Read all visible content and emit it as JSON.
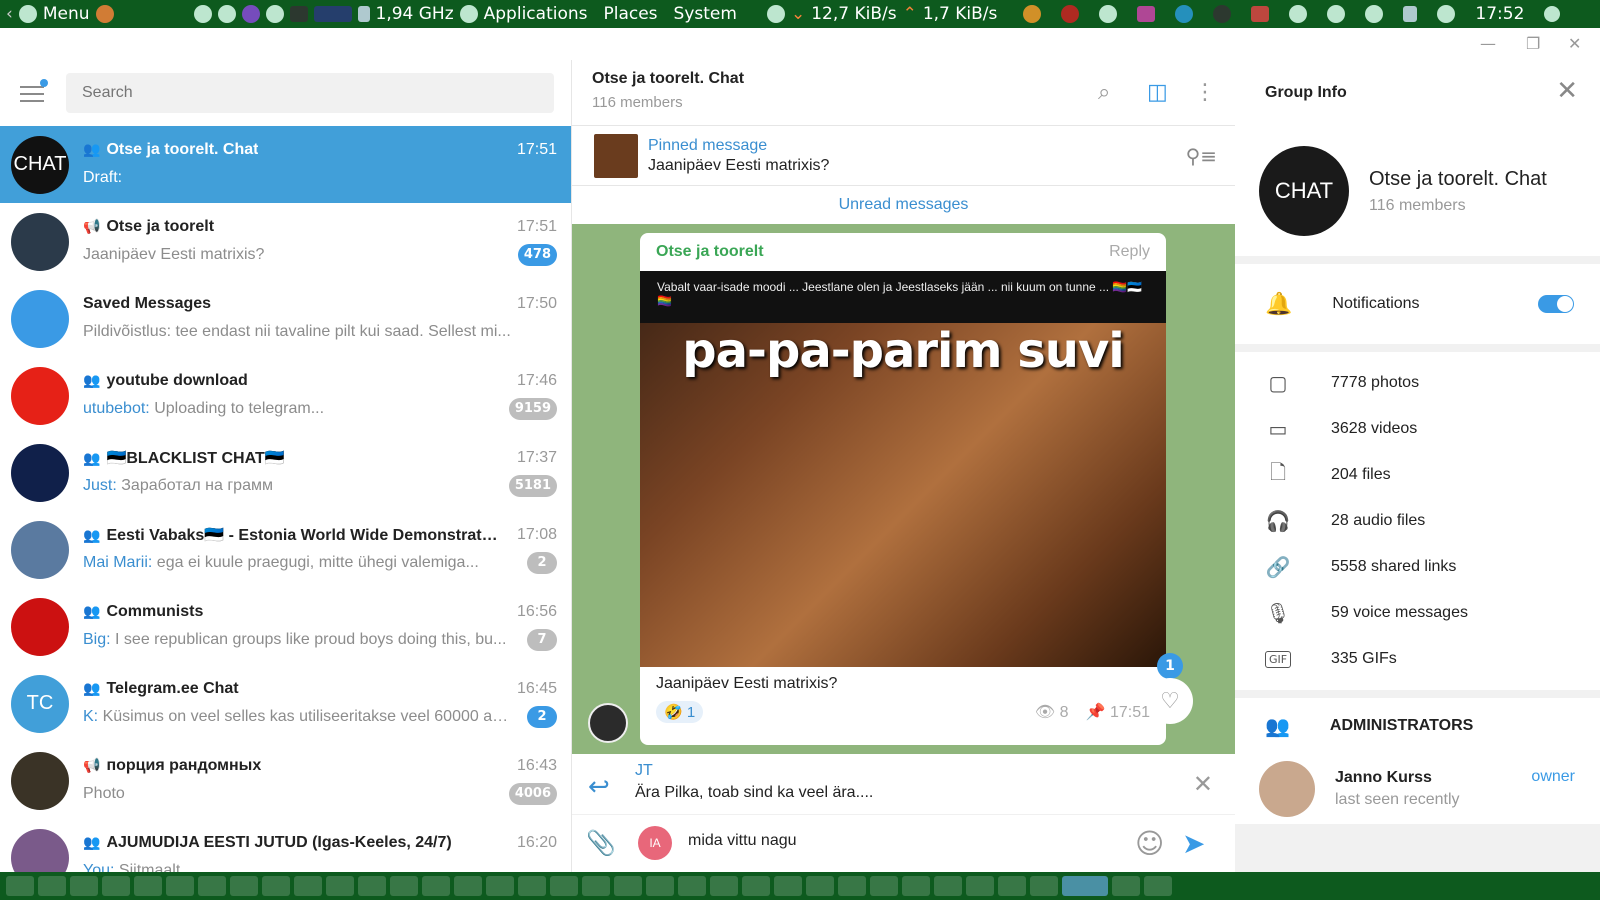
{
  "sysbar": {
    "menu": "Menu",
    "cpu": "1,94 GHz",
    "applications": "Applications",
    "places": "Places",
    "system": "System",
    "net_down": "12,7 KiB/s",
    "net_up": "1,7 KiB/s",
    "clock": "17:52"
  },
  "search": {
    "placeholder": "Search"
  },
  "chats": [
    {
      "name": "Otse ja toorelt. Chat",
      "time": "17:51",
      "preview": "Draft:",
      "sender": "",
      "badge": "",
      "avatar_text": "CHAT",
      "kind": "group",
      "color": "#111111"
    },
    {
      "name": "Otse ja toorelt",
      "time": "17:51",
      "preview": "Jaanipäev Eesti matrixis?",
      "sender": "",
      "badge": "478",
      "avatar_text": "",
      "kind": "channel",
      "color": "#2b3a4a"
    },
    {
      "name": "Saved Messages",
      "time": "17:50",
      "preview": "Pildivõistlus: tee endast nii tavaline pilt kui saad. Sellest mi...",
      "sender": "",
      "badge": "",
      "avatar_text": "",
      "kind": "saved",
      "color": "#3a9ae5"
    },
    {
      "name": "youtube download",
      "time": "17:46",
      "preview": "Uploading to telegram...",
      "sender": "utubebot:",
      "badge": "9159",
      "avatar_text": "",
      "kind": "group",
      "color": "#e62117"
    },
    {
      "name": "🇪🇪BLACKLIST CHAT🇪🇪",
      "time": "17:37",
      "preview": "Заработал на грамм",
      "sender": "Just:",
      "badge": "5181",
      "avatar_text": "",
      "kind": "group",
      "color": "#10204a"
    },
    {
      "name": "Eesti Vabaks🇪🇪 - Estonia World Wide Demonstrati...",
      "time": "17:08",
      "preview": "ega ei kuule praegugi, mitte ühegi valemiga...",
      "sender": "Mai Marii:",
      "badge": "2",
      "avatar_text": "",
      "kind": "group",
      "color": "#5a7aa0"
    },
    {
      "name": "Communists",
      "time": "16:56",
      "preview": "I see republican groups like proud boys doing this, bu...",
      "sender": "Big:",
      "badge": "7",
      "avatar_text": "",
      "kind": "group",
      "color": "#cc1111"
    },
    {
      "name": "Telegram.ee Chat",
      "time": "16:45",
      "preview": "Küsimus on veel selles kas utiliseeritakse veel 60000 ah...",
      "sender": "K:",
      "badge": "2",
      "avatar_text": "TC",
      "kind": "group",
      "color": "#419fd9"
    },
    {
      "name": "порция рандомных",
      "time": "16:43",
      "preview": "Photo",
      "sender": "",
      "badge": "4006",
      "avatar_text": "",
      "kind": "channel",
      "color": "#3a3326"
    },
    {
      "name": "AJUMUDIJA EESTI JUTUD (Igas-Keeles, 24/7)",
      "time": "16:20",
      "preview": "Siitmaalt",
      "sender": "You:",
      "badge": "",
      "avatar_text": "",
      "kind": "group",
      "color": "#7a5a8a"
    }
  ],
  "header": {
    "title": "Otse ja toorelt. Chat",
    "subtitle": "116 members"
  },
  "pinned": {
    "label": "Pinned message",
    "text": "Jaanipäev Eesti matrixis?"
  },
  "unread": "Unread messages",
  "message": {
    "from": "Otse ja toorelt",
    "reply": "Reply",
    "caption_top": "Vabalt vaar-isade moodi ... Jeestlane olen ja Jeestlaseks jään ... nii kuum on tunne ... 🏳️‍🌈🇪🇪🏳️‍🌈",
    "meme_text": "pa-pa-parim suvi",
    "text": "Jaanipäev Eesti matrixis?",
    "reaction": "🤣 1",
    "views": "👁 8",
    "time": "📌 17:51",
    "heart_badge": "1"
  },
  "reply_bar": {
    "name": "JT",
    "text": "Ära Pilka, toab sind ka veel ära...."
  },
  "composer": {
    "avatar": "IA",
    "value": "mida vittu nagu"
  },
  "group_info": {
    "title": "Group Info",
    "name": "Otse ja toorelt. Chat",
    "members": "116 members",
    "avatar_text": "CHAT",
    "notifications": "Notifications",
    "media": [
      {
        "icon": "▢",
        "label": "7778 photos",
        "name": "photos"
      },
      {
        "icon": "▭",
        "label": "3628 videos",
        "name": "videos"
      },
      {
        "icon": "🗋",
        "label": "204 files",
        "name": "files"
      },
      {
        "icon": "🎧",
        "label": "28 audio files",
        "name": "audio"
      },
      {
        "icon": "🔗",
        "label": "5558 shared links",
        "name": "links"
      },
      {
        "icon": "🎙",
        "label": "59 voice messages",
        "name": "voice"
      },
      {
        "icon": "GIF",
        "label": "335 GIFs",
        "name": "gifs"
      }
    ],
    "admins_label": "ADMINISTRATORS",
    "admin": {
      "name": "Janno Kurss",
      "status": "last seen recently",
      "role": "owner"
    }
  }
}
